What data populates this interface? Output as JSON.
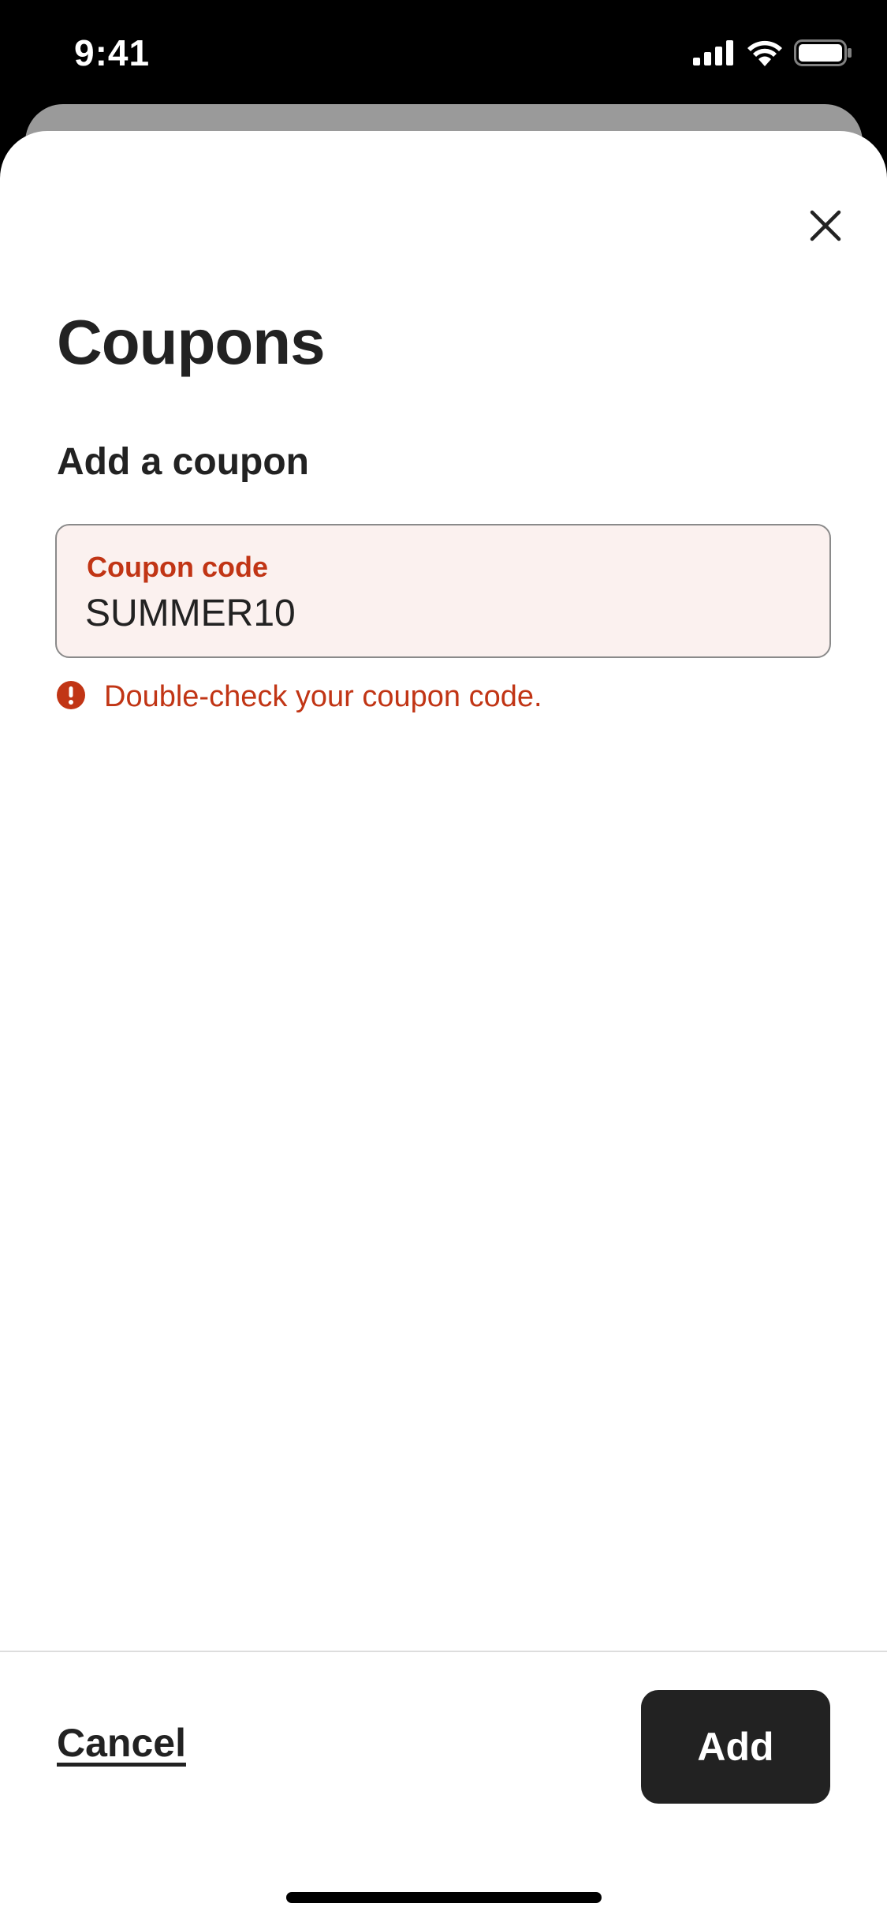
{
  "status_bar": {
    "time": "9:41",
    "icons": [
      "cellular-signal-icon",
      "wifi-icon",
      "battery-icon"
    ]
  },
  "sheet": {
    "close_icon": "close-icon",
    "title": "Coupons",
    "section_title": "Add a coupon",
    "coupon_field": {
      "label": "Coupon code",
      "value": "SUMMER10",
      "state": "error"
    },
    "error": {
      "icon": "error-icon",
      "message": "Double-check your coupon code."
    }
  },
  "footer": {
    "cancel_label": "Cancel",
    "add_label": "Add"
  },
  "colors": {
    "error": "#c13515",
    "error_background": "#fbf1ef",
    "text_primary": "#222222",
    "button_background": "#222222",
    "button_text": "#ffffff"
  }
}
